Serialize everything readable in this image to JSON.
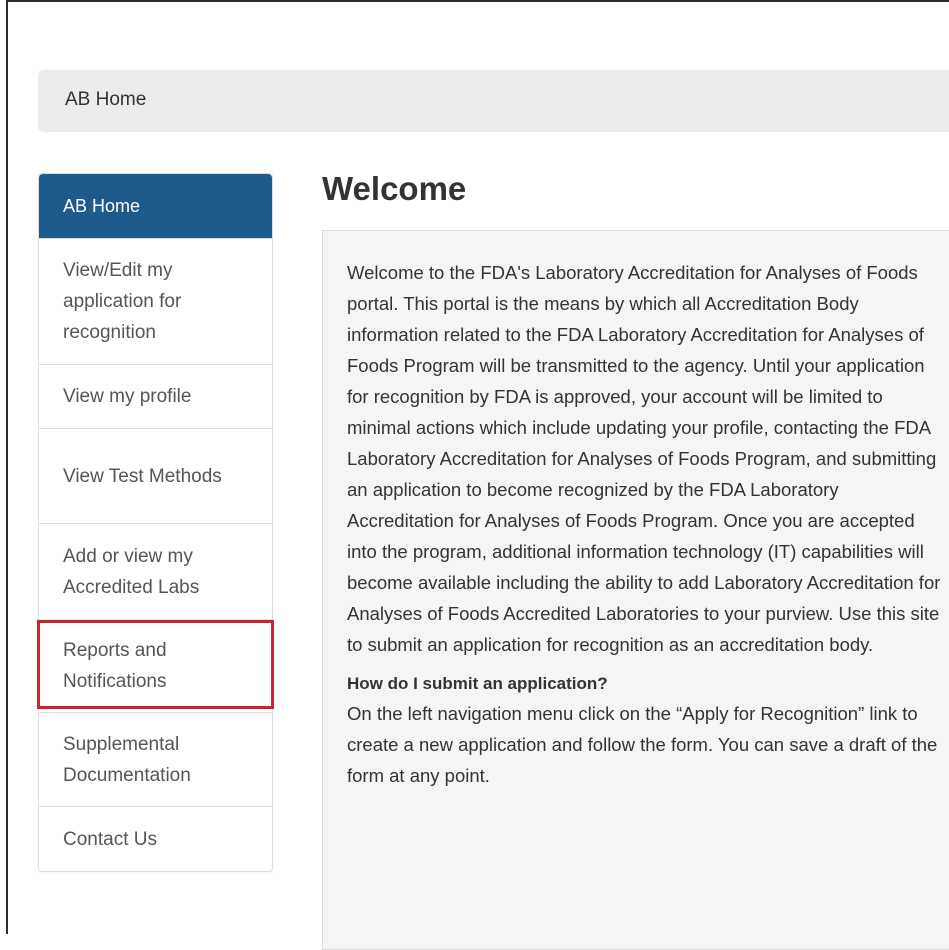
{
  "breadcrumb": {
    "label": "AB Home"
  },
  "sidebar": {
    "items": [
      {
        "label": "AB Home"
      },
      {
        "label": "View/Edit my application for recognition"
      },
      {
        "label": "View my profile"
      },
      {
        "label": "View Test Methods"
      },
      {
        "label": "Add or view my Accredited Labs"
      },
      {
        "label": "Reports and Notifications"
      },
      {
        "label": "Supplemental Documentation"
      },
      {
        "label": "Contact Us"
      }
    ]
  },
  "main": {
    "title": "Welcome",
    "intro": "Welcome to the FDA's Laboratory Accreditation for Analyses of Foods portal. This portal is the means by which all Accreditation Body information related to the FDA Laboratory Accreditation for Analyses of Foods Program will be transmitted to the agency. Until your application for recognition by FDA is approved, your account will be limited to minimal actions which include updating your profile, contacting the FDA Laboratory Accreditation for Analyses of Foods Program, and submitting an application to become recognized by the FDA Laboratory Accreditation for Analyses of Foods Program. Once you are accepted into the program, additional information technology (IT) capabilities will become available including the ability to add Laboratory Accreditation for Analyses of Foods Accredited Laboratories to your purview. Use this site to submit an application for recognition as an accreditation body.",
    "faq_question": "How do I submit an application?",
    "faq_answer": "On the left navigation menu click on the “Apply for Recognition” link to create a new application and follow the form. You can save a draft of the form at any point."
  },
  "colors": {
    "active_nav": "#1f5a8c",
    "highlight": "#c7242b"
  }
}
